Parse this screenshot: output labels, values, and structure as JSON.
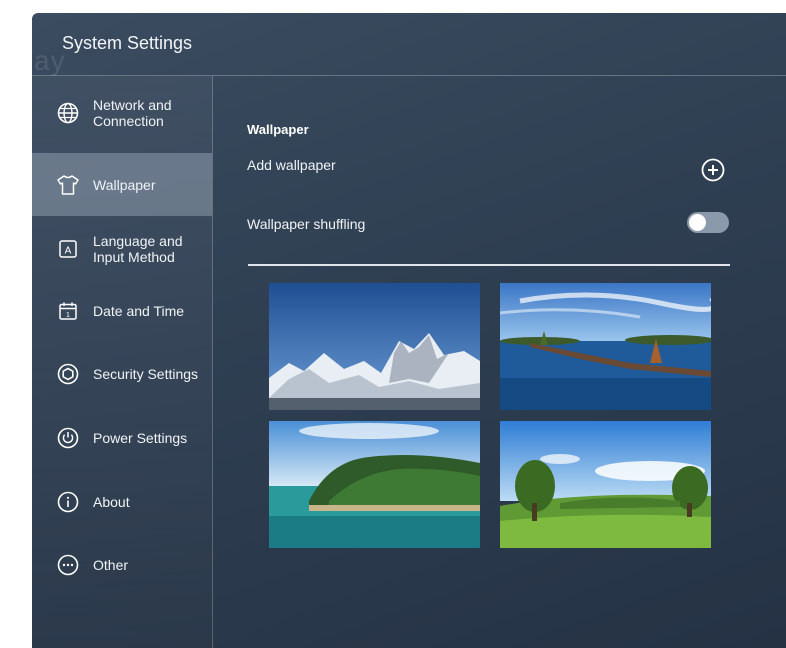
{
  "window": {
    "title": "System Settings",
    "ghost_text": "ay"
  },
  "sidebar": {
    "items": [
      {
        "label": "Network and\nConnection",
        "icon": "globe-icon",
        "active": false
      },
      {
        "label": "Wallpaper",
        "icon": "tshirt-icon",
        "active": true
      },
      {
        "label": "Language and\nInput Method",
        "icon": "keyboard-a-icon",
        "active": false
      },
      {
        "label": "Date and Time",
        "icon": "calendar-icon",
        "active": false
      },
      {
        "label": "Security Settings",
        "icon": "shield-gear-icon",
        "active": false
      },
      {
        "label": "Power Settings",
        "icon": "power-icon",
        "active": false
      },
      {
        "label": "About",
        "icon": "info-icon",
        "active": false
      },
      {
        "label": "Other",
        "icon": "more-dots-icon",
        "active": false
      }
    ]
  },
  "main": {
    "section_title": "Wallpaper",
    "add_wallpaper_label": "Add wallpaper",
    "shuffle_label": "Wallpaper shuffling",
    "shuffle_on": false,
    "wallpapers": [
      {
        "name": "snowy-mountains"
      },
      {
        "name": "lake-rocky-spit"
      },
      {
        "name": "forested-island"
      },
      {
        "name": "green-meadow-trees"
      }
    ]
  },
  "colors": {
    "background": "#33445a",
    "active_item": "#8fa0b2",
    "toggle_track": "#8a9aab",
    "text": "#ffffff"
  }
}
